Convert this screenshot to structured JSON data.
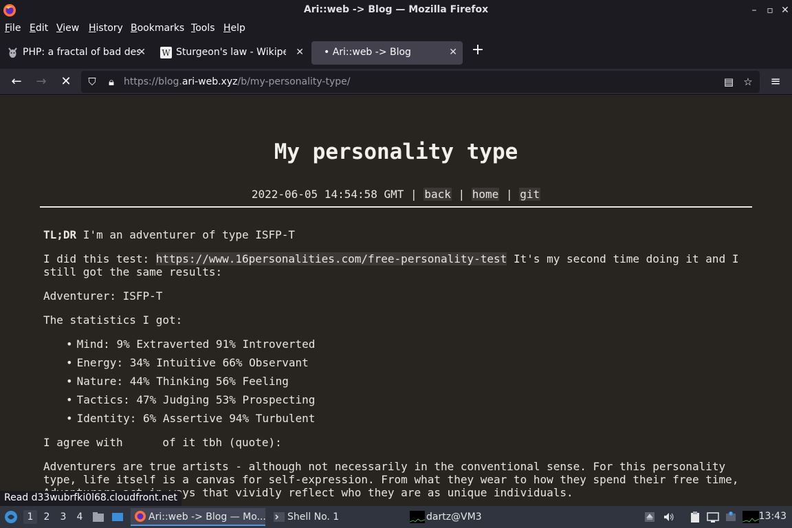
{
  "window": {
    "title": "Ari::web -> Blog — Mozilla Firefox"
  },
  "menu": [
    "File",
    "Edit",
    "View",
    "History",
    "Bookmarks",
    "Tools",
    "Help"
  ],
  "tabs": [
    {
      "label": "PHP: a fractal of bad desi",
      "icon": "php-favicon-icon",
      "active": false
    },
    {
      "label": "Sturgeon's law - Wikipedi",
      "icon": "wikipedia-icon",
      "active": false
    },
    {
      "label": "• Ari::web -> Blog",
      "icon": "",
      "active": true
    }
  ],
  "url": {
    "prefix": "https://blog.",
    "domain": "ari-web.xyz",
    "path": "/b/my-personality-type/"
  },
  "page": {
    "title": "My personality type",
    "date": "2022-06-05 14:54:58 GMT",
    "sep": "|",
    "links": [
      "back",
      "home",
      "git"
    ],
    "tldr_bold": "TL;DR",
    "tldr_text": " I'm an adventurer of type ISFP-T",
    "p1_a": "I did this test: ",
    "p1_link": "https://www.16personalities.com/free-personality-test",
    "p1_b": " It's my second time doing it and I still got the same results:",
    "p2": "Adventurer: ISFP-T",
    "p3": "The statistics I got:",
    "stats": [
      "Mind: 9% Extraverted 91% Introverted",
      "Energy: 34% Intuitive 66% Observant",
      "Nature: 44% Thinking 56% Feeling",
      "Tactics: 47% Judging 53% Prospecting",
      "Identity: 6% Assertive 94% Turbulent"
    ],
    "p4": "I agree with      of it tbh (quote):",
    "quote": "Adventurers are true artists - although not necessarily in the conventional sense. For this personality type, life itself is a canvas for self-expression. From what they wear to how they spend their free time, Adventurers act in ways that vividly reflect who they are as unique individuals."
  },
  "status": "Read d33wubrfki0l68.cloudfront.net",
  "taskbar": {
    "workspaces": [
      "1",
      "2",
      "3",
      "4"
    ],
    "tasks": [
      "Ari::web -> Blog — Mo...",
      "Shell No. 1",
      "dartz@VM3"
    ],
    "clock": "13:43"
  },
  "colors": {
    "page_bg": "#282520",
    "chrome_bg": "#1c1b22",
    "accent": "#5294e2"
  }
}
